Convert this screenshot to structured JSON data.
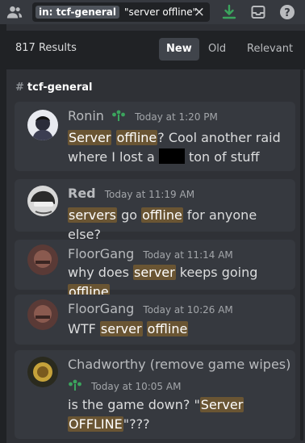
{
  "toolbar": {
    "search_filter": "in: tcf-general",
    "search_query": "\"server offline\"",
    "clear_icon": "×",
    "icons": [
      "members-icon",
      "download-icon",
      "inbox-icon",
      "help-icon"
    ],
    "download_icon_color": "#3ba55d"
  },
  "results": {
    "count_label": "817 Results",
    "sort_new": "New",
    "sort_old": "Old",
    "sort_relevant": "Relevant",
    "active_sort": "New"
  },
  "channel": {
    "hash": "#",
    "name": "tcf-general"
  },
  "messages": [
    {
      "author": "Ronin",
      "timestamp": "Today at 1:20 PM",
      "has_badge": true,
      "segments": [
        {
          "t": "Server",
          "hl": true
        },
        {
          "t": " ",
          "hl": false
        },
        {
          "t": "offline",
          "hl": true
        },
        {
          "t": "? Cool another raid where I lost a ",
          "hl": false
        },
        {
          "t": "",
          "redacted": true
        },
        {
          "t": " ton of stuff",
          "hl": false
        }
      ]
    },
    {
      "author": "Red",
      "timestamp": "Today at 11:19 AM",
      "has_badge": false,
      "segments": [
        {
          "t": "servers",
          "hl": true
        },
        {
          "t": " go ",
          "hl": false
        },
        {
          "t": "offline",
          "hl": true
        },
        {
          "t": " for anyone else?",
          "hl": false
        }
      ]
    },
    {
      "author": "FloorGang",
      "timestamp": "Today at 11:14 AM",
      "has_badge": false,
      "segments": [
        {
          "t": "why does ",
          "hl": false
        },
        {
          "t": "server",
          "hl": true
        },
        {
          "t": " keeps going ",
          "hl": false
        },
        {
          "t": "offline",
          "hl": true
        }
      ]
    },
    {
      "author": "FloorGang",
      "timestamp": "Today at 10:26 AM",
      "has_badge": false,
      "segments": [
        {
          "t": "WTF ",
          "hl": false
        },
        {
          "t": "server",
          "hl": true
        },
        {
          "t": " ",
          "hl": false
        },
        {
          "t": "offline",
          "hl": true
        }
      ]
    },
    {
      "author": "Chadworthy (remove game wipes)",
      "timestamp": "Today at 10:05 AM",
      "has_badge": true,
      "segments": [
        {
          "t": "is the game down? \"",
          "hl": false
        },
        {
          "t": "Server",
          "hl": true
        },
        {
          "t": " ",
          "hl": false
        },
        {
          "t": "OFFLINE",
          "hl": true
        },
        {
          "t": "\"???",
          "hl": false
        }
      ]
    }
  ],
  "colors": {
    "highlight": "#6a5533",
    "badge": "#3ba55d"
  }
}
